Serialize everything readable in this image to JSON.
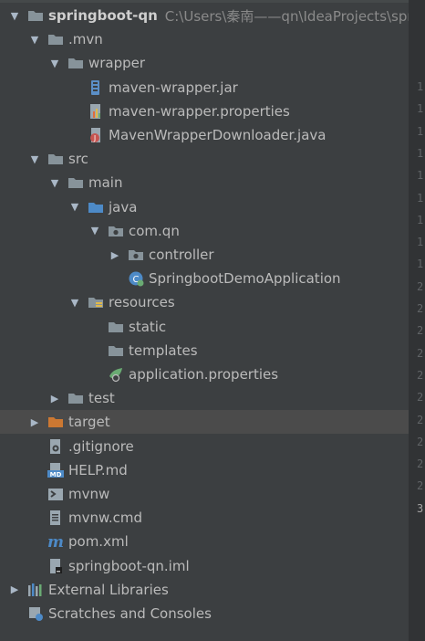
{
  "colors": {
    "background": "#3c3f41",
    "selected_row": "#4b4b4b",
    "folder": "#87939a",
    "source_folder": "#4d8ac7",
    "excluded_folder": "#cc7832"
  },
  "tree": {
    "root": {
      "label": "springboot-qn",
      "path": "C:\\Users\\秦南——qn\\IdeaProjects\\spri"
    },
    "items": [
      {
        "label": ".mvn",
        "icon": "folder-icon",
        "expanded": true
      },
      {
        "label": "wrapper",
        "icon": "folder-icon",
        "expanded": true
      },
      {
        "label": "maven-wrapper.jar",
        "icon": "jar-file-icon"
      },
      {
        "label": "maven-wrapper.properties",
        "icon": "properties-file-icon"
      },
      {
        "label": "MavenWrapperDownloader.java",
        "icon": "java-file-icon"
      },
      {
        "label": "src",
        "icon": "folder-icon",
        "expanded": true
      },
      {
        "label": "main",
        "icon": "folder-icon",
        "expanded": true
      },
      {
        "label": "java",
        "icon": "source-folder-icon",
        "expanded": true
      },
      {
        "label": "com.qn",
        "icon": "package-icon",
        "expanded": true
      },
      {
        "label": "controller",
        "icon": "package-icon",
        "expanded": false
      },
      {
        "label": "SpringbootDemoApplication",
        "icon": "spring-boot-class-icon"
      },
      {
        "label": "resources",
        "icon": "resources-folder-icon",
        "expanded": true
      },
      {
        "label": "static",
        "icon": "folder-icon"
      },
      {
        "label": "templates",
        "icon": "folder-icon"
      },
      {
        "label": "application.properties",
        "icon": "spring-properties-icon"
      },
      {
        "label": "test",
        "icon": "folder-icon",
        "expanded": false
      },
      {
        "label": "target",
        "icon": "excluded-folder-icon",
        "expanded": false,
        "selected": true
      },
      {
        "label": ".gitignore",
        "icon": "gitignore-file-icon"
      },
      {
        "label": "HELP.md",
        "icon": "markdown-file-icon"
      },
      {
        "label": "mvnw",
        "icon": "shell-script-icon"
      },
      {
        "label": "mvnw.cmd",
        "icon": "text-file-icon"
      },
      {
        "label": "pom.xml",
        "icon": "maven-pom-icon"
      },
      {
        "label": "springboot-qn.iml",
        "icon": "iml-file-icon"
      },
      {
        "label": "External Libraries",
        "icon": "external-libraries-icon",
        "expanded": false
      },
      {
        "label": "Scratches and Consoles",
        "icon": "scratches-icon"
      }
    ]
  },
  "gutter": {
    "line_numbers": [
      "1",
      "1",
      "1",
      "1",
      "1",
      "1",
      "1",
      "1",
      "1",
      "2",
      "2",
      "2",
      "2",
      "2",
      "2",
      "2",
      "2",
      "2",
      "2",
      "3"
    ]
  }
}
